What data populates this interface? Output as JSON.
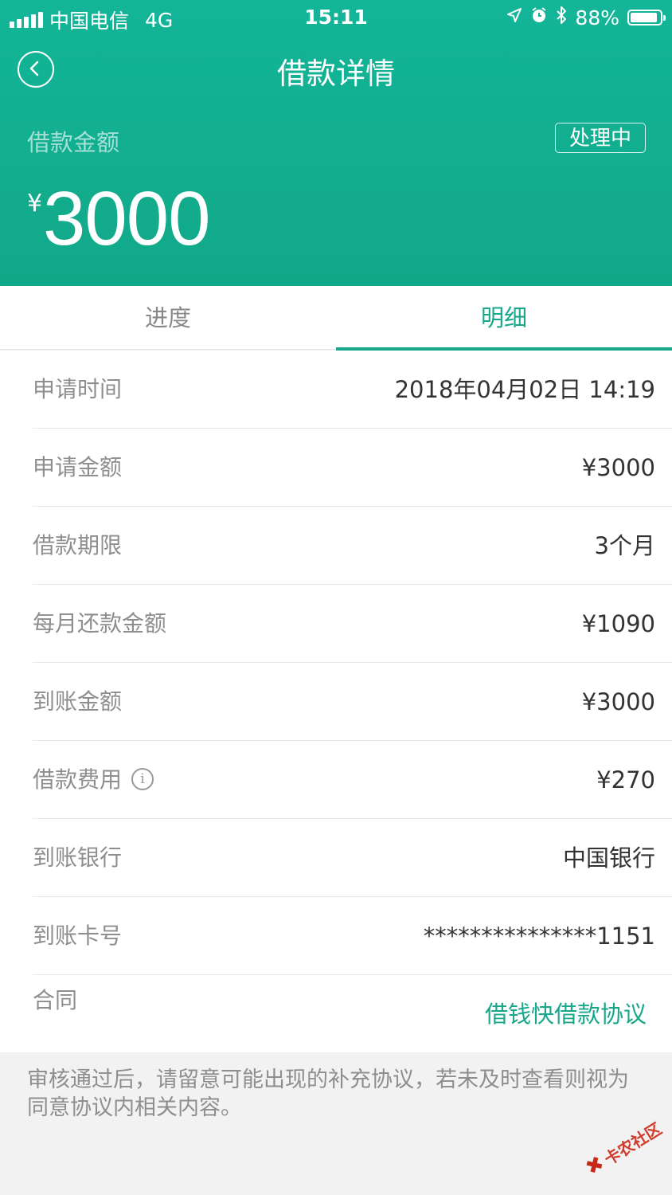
{
  "status_bar": {
    "carrier": "中国电信",
    "network": "4G",
    "time": "15:11",
    "battery": "88%",
    "icons": [
      "signal-icon",
      "location-icon",
      "alarm-icon",
      "bluetooth-icon",
      "battery-icon"
    ]
  },
  "nav": {
    "back_icon": "chevron-left-icon",
    "title": "借款详情"
  },
  "summary": {
    "amount_label": "借款金额",
    "status": "处理中",
    "currency_symbol": "¥",
    "amount": "3000"
  },
  "tabs": [
    {
      "label": "进度",
      "active": false
    },
    {
      "label": "明细",
      "active": true
    }
  ],
  "details": [
    {
      "label": "申请时间",
      "value": "2018年04月02日 14:19"
    },
    {
      "label": "申请金额",
      "value": "¥3000"
    },
    {
      "label": "借款期限",
      "value": "3个月"
    },
    {
      "label": "每月还款金额",
      "value": "¥1090"
    },
    {
      "label": "到账金额",
      "value": "¥3000"
    },
    {
      "label": "借款费用",
      "value": "¥270",
      "icon": "info-icon"
    },
    {
      "label": "到账银行",
      "value": "中国银行"
    },
    {
      "label": "到账卡号",
      "value": "***************1151"
    },
    {
      "label": "合同",
      "value": "借钱快借款协议"
    }
  ],
  "notice": "审核通过后，请留意可能出现的补充协议，若未及时查看则视为同意协议内相关内容。",
  "watermark": "卡农社区",
  "colors": {
    "header": "#13b598",
    "accent": "#18a78a",
    "label_text": "#8e8e8e",
    "value_text": "#333333",
    "background": "#f2f2f2"
  }
}
